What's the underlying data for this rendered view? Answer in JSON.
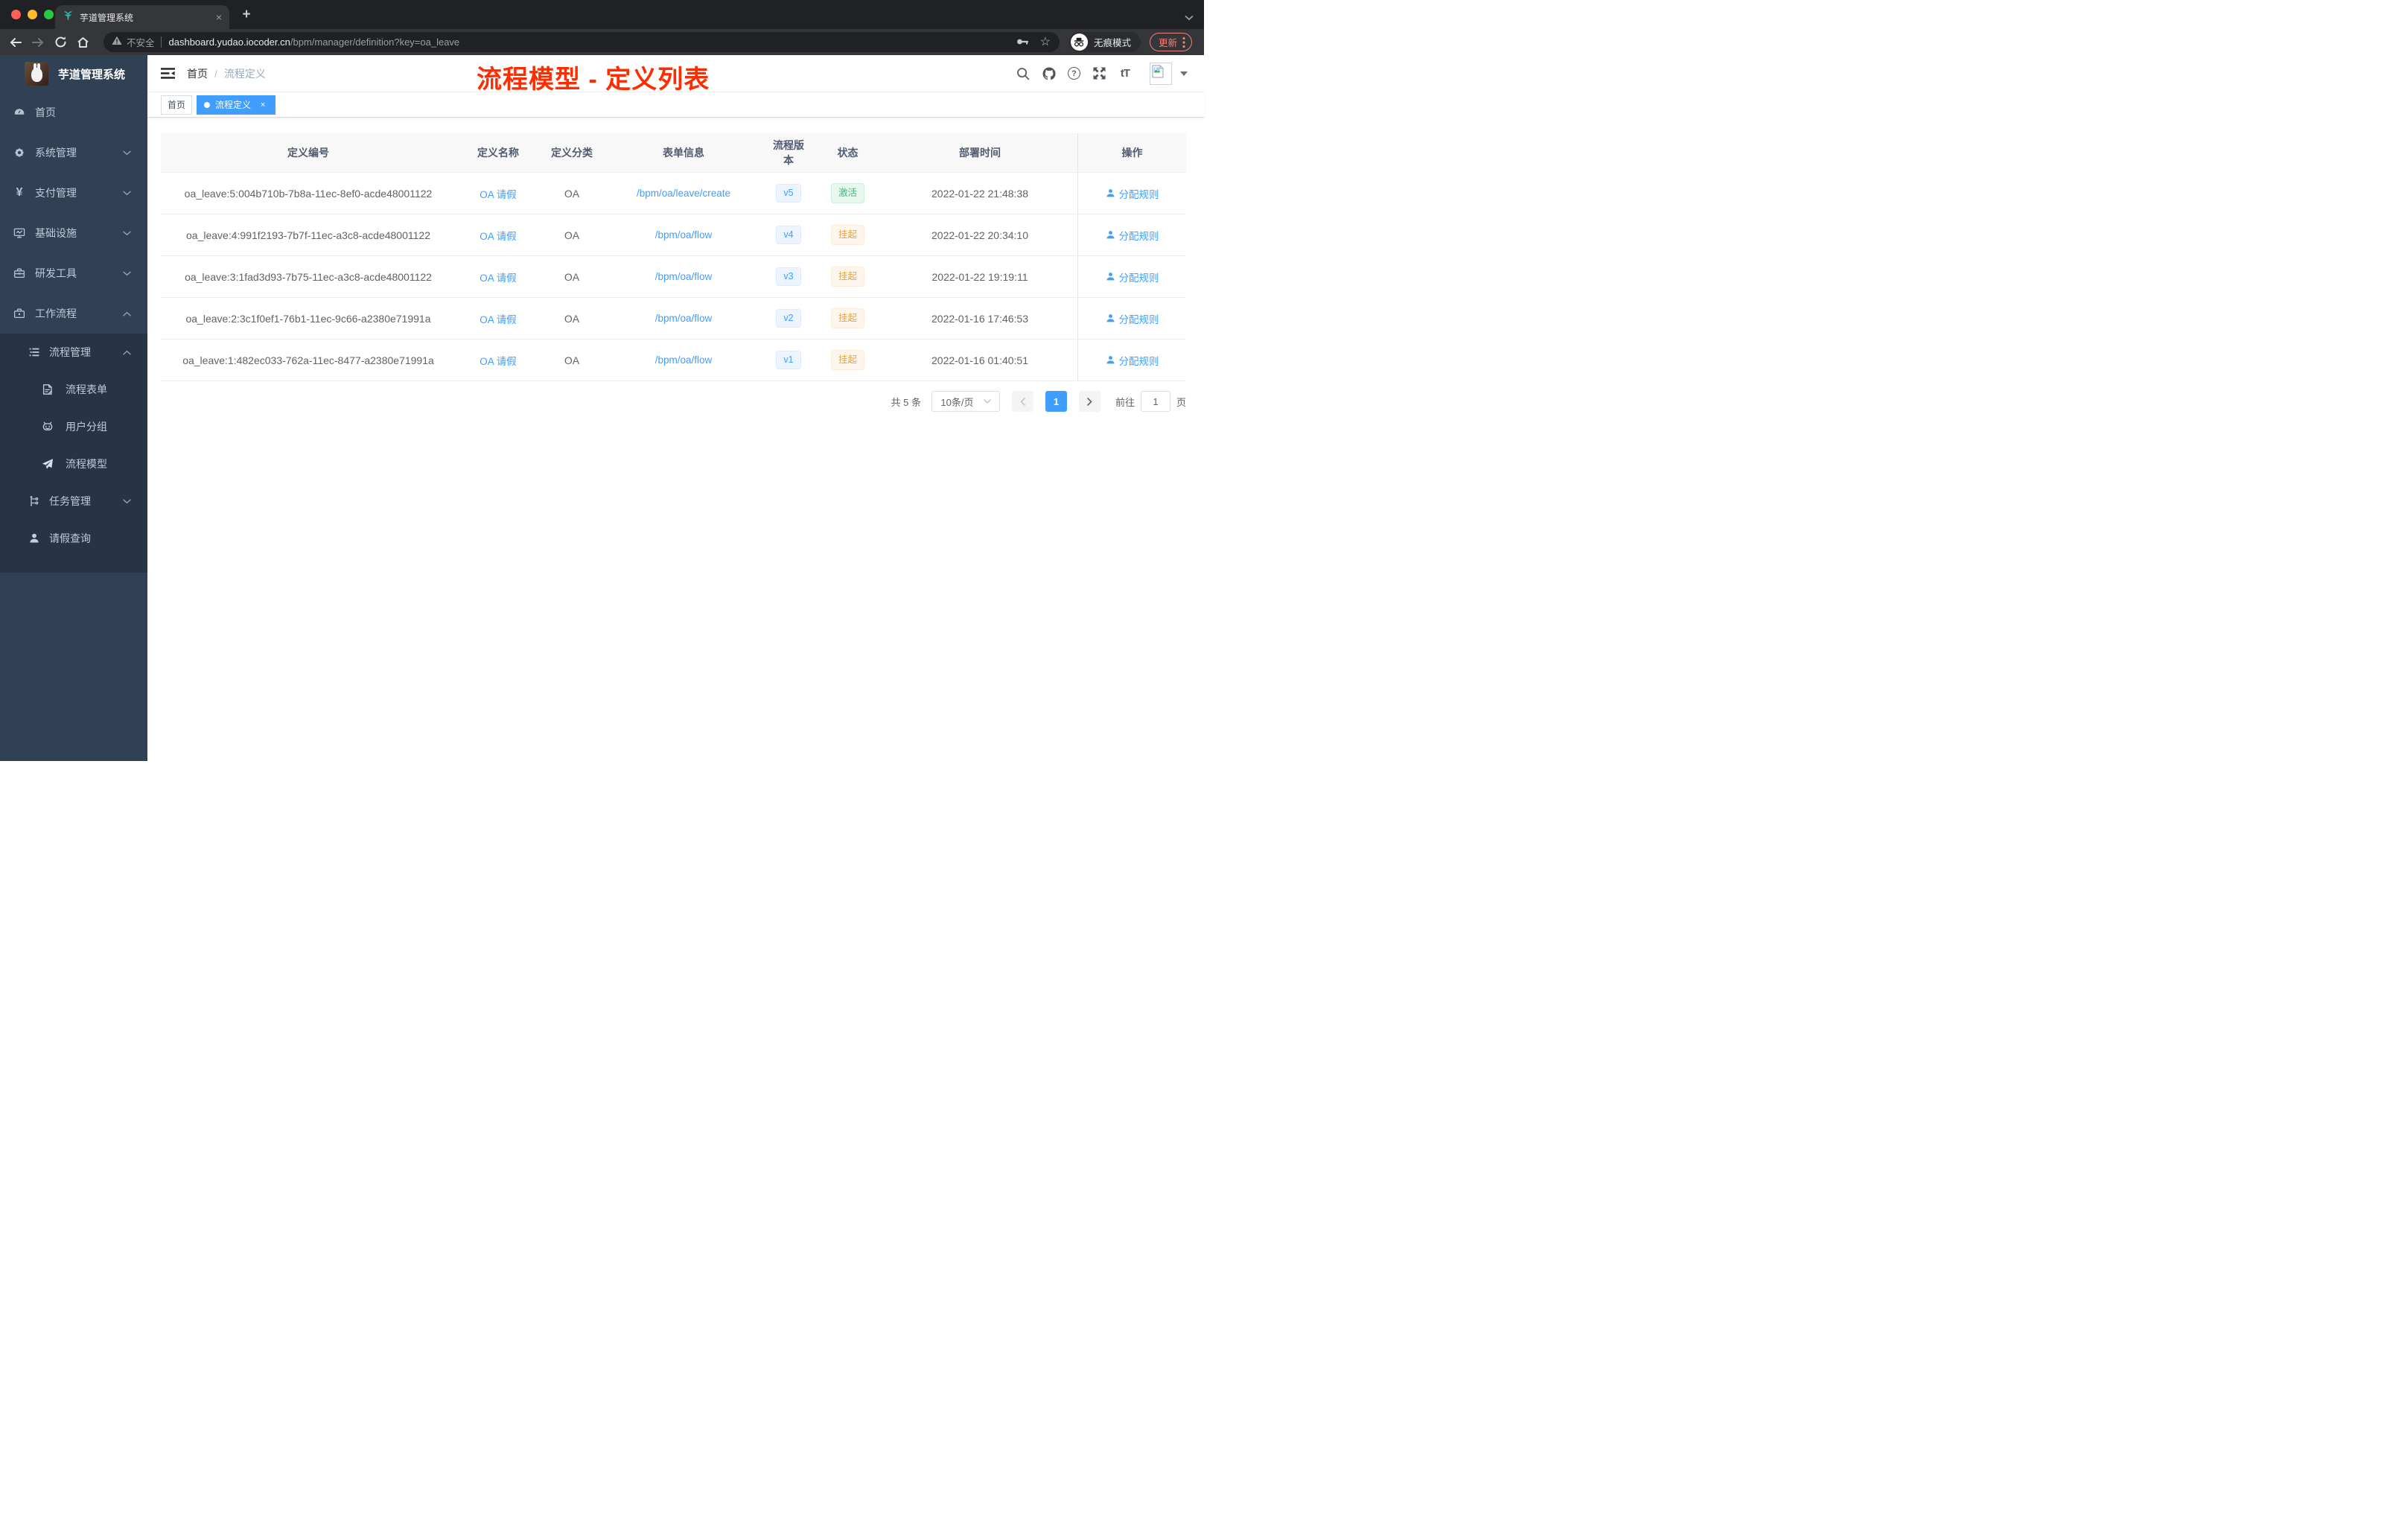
{
  "browser": {
    "tab_title": "芋道管理系统",
    "new_tab_glyph": "+",
    "tab_close_glyph": "×",
    "address": {
      "security_label": "不安全",
      "domain": "dashboard.yudao.iocoder.cn",
      "path": "/bpm/manager/definition?key=oa_leave"
    },
    "incognito_label": "无痕模式",
    "update_label": "更新",
    "bookmark_glyph": "☆"
  },
  "sidebar": {
    "logo_title": "芋道管理系统",
    "items": [
      {
        "label": "首页",
        "icon": "dashboard-icon"
      },
      {
        "label": "系统管理",
        "icon": "gear-icon",
        "chevron": "down"
      },
      {
        "label": "支付管理",
        "icon": "yen-icon",
        "chevron": "down"
      },
      {
        "label": "基础设施",
        "icon": "monitor-icon",
        "chevron": "down"
      },
      {
        "label": "研发工具",
        "icon": "toolbox-icon",
        "chevron": "down"
      },
      {
        "label": "工作流程",
        "icon": "briefcase-icon",
        "chevron": "up"
      }
    ],
    "submenu": [
      {
        "label": "流程管理",
        "icon": "list-icon",
        "chevron": "up"
      },
      {
        "label": "流程表单",
        "icon": "form-icon"
      },
      {
        "label": "用户分组",
        "icon": "user-group-icon"
      },
      {
        "label": "流程模型",
        "icon": "paper-plane-icon"
      },
      {
        "label": "任务管理",
        "icon": "task-tree-icon",
        "chevron": "down"
      },
      {
        "label": "请假查询",
        "icon": "person-icon"
      }
    ],
    "yen_glyph": "¥"
  },
  "header": {
    "breadcrumb": {
      "home": "首页",
      "separator": "/",
      "current": "流程定义"
    },
    "annotation": "流程模型 - 定义列表",
    "help_glyph": "?",
    "font_size_glyph": "tT"
  },
  "tags": {
    "home": "首页",
    "active": "流程定义",
    "close_glyph": "×"
  },
  "table": {
    "columns": [
      "定义编号",
      "定义名称",
      "定义分类",
      "表单信息",
      "流程版本",
      "状态",
      "部署时间",
      "操作"
    ],
    "rows": [
      {
        "id": "oa_leave:5:004b710b-7b8a-11ec-8ef0-acde48001122",
        "name": "OA 请假",
        "category": "OA",
        "form": "/bpm/oa/leave/create",
        "version": "v5",
        "status": "激活",
        "time": "2022-01-22 21:48:38",
        "action": "分配规则"
      },
      {
        "id": "oa_leave:4:991f2193-7b7f-11ec-a3c8-acde48001122",
        "name": "OA 请假",
        "category": "OA",
        "form": "/bpm/oa/flow",
        "version": "v4",
        "status": "挂起",
        "time": "2022-01-22 20:34:10",
        "action": "分配规则"
      },
      {
        "id": "oa_leave:3:1fad3d93-7b75-11ec-a3c8-acde48001122",
        "name": "OA 请假",
        "category": "OA",
        "form": "/bpm/oa/flow",
        "version": "v3",
        "status": "挂起",
        "time": "2022-01-22 19:19:11",
        "action": "分配规则"
      },
      {
        "id": "oa_leave:2:3c1f0ef1-76b1-11ec-9c66-a2380e71991a",
        "name": "OA 请假",
        "category": "OA",
        "form": "/bpm/oa/flow",
        "version": "v2",
        "status": "挂起",
        "time": "2022-01-16 17:46:53",
        "action": "分配规则"
      },
      {
        "id": "oa_leave:1:482ec033-762a-11ec-8477-a2380e71991a",
        "name": "OA 请假",
        "category": "OA",
        "form": "/bpm/oa/flow",
        "version": "v1",
        "status": "挂起",
        "time": "2022-01-16 01:40:51",
        "action": "分配规则"
      }
    ]
  },
  "pagination": {
    "total_label": "共 5 条",
    "page_size": "10条/页",
    "current_page": "1",
    "goto_label": "前往",
    "goto_value": "1",
    "page_unit": "页"
  },
  "colors": {
    "accent": "#409eff",
    "annotation_red": "#fe2c00",
    "sidebar_bg": "#304156",
    "submenu_bg": "#263445",
    "success_text": "#42b983",
    "warning_text": "#e6a23c",
    "tab_bg": "#35363a",
    "chrome_bg": "#202124"
  }
}
